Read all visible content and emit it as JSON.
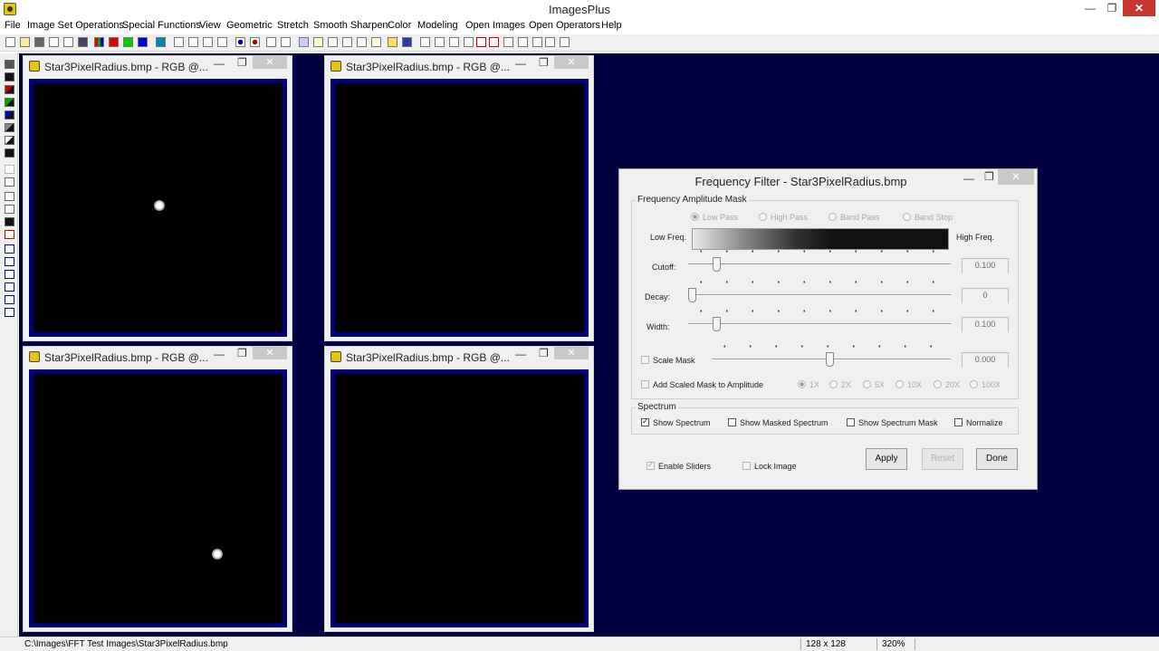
{
  "app": {
    "title": "ImagesPlus"
  },
  "window_controls": {
    "minimize": "—",
    "maximize": "❐",
    "close": "✕"
  },
  "menu": [
    "File",
    "Image Set Operations",
    "Special Functions",
    "View",
    "Geometric",
    "Stretch",
    "Smooth Sharpen",
    "Color",
    "Modeling",
    "Open Images",
    "Open Operators",
    "Help"
  ],
  "image_windows": [
    {
      "title": "Star3PixelRadius.bmp - RGB @...",
      "content": "star"
    },
    {
      "title": "Star3PixelRadius.bmp - RGB @...",
      "content": "spectrum"
    },
    {
      "title": "Star3PixelRadius.bmp - RGB @...",
      "content": "star"
    },
    {
      "title": "Star3PixelRadius.bmp - RGB @...",
      "content": "spectrum"
    }
  ],
  "dialog": {
    "title": "Frequency Filter - Star3PixelRadius.bmp",
    "mask_group": "Frequency Amplitude Mask",
    "filter_types": [
      "Low Pass",
      "High Pass",
      "Band Pass",
      "Band Stop"
    ],
    "selected_filter": "Low Pass",
    "low_freq_label": "Low Freq.",
    "high_freq_label": "High Freq.",
    "cutoff": {
      "label": "Cutoff:",
      "value": "0.100",
      "position": 0.1
    },
    "decay": {
      "label": "Decay:",
      "value": "0",
      "position": 0.0
    },
    "width": {
      "label": "Width:",
      "value": "0.100",
      "position": 0.1
    },
    "scale_mask": {
      "label": "Scale Mask",
      "value": "0.000",
      "position": 0.5
    },
    "add_scaled": "Add Scaled Mask to Amplitude",
    "multipliers": [
      "1X",
      "2X",
      "5X",
      "10X",
      "20X",
      "100X"
    ],
    "selected_multiplier": "1X",
    "spectrum_group": "Spectrum",
    "show_spectrum": "Show Spectrum",
    "show_masked_spectrum": "Show Masked Spectrum",
    "show_spectrum_mask": "Show Spectrum Mask",
    "normalize": "Normalize",
    "enable_sliders": "Enable Sliders",
    "lock_image": "Lock Image",
    "apply": "Apply",
    "reset": "Reset",
    "done": "Done"
  },
  "status": {
    "path": "C:\\Images\\FFT Test Images\\Star3PixelRadius.bmp",
    "size": "128 x 128",
    "zoom": "320%"
  }
}
